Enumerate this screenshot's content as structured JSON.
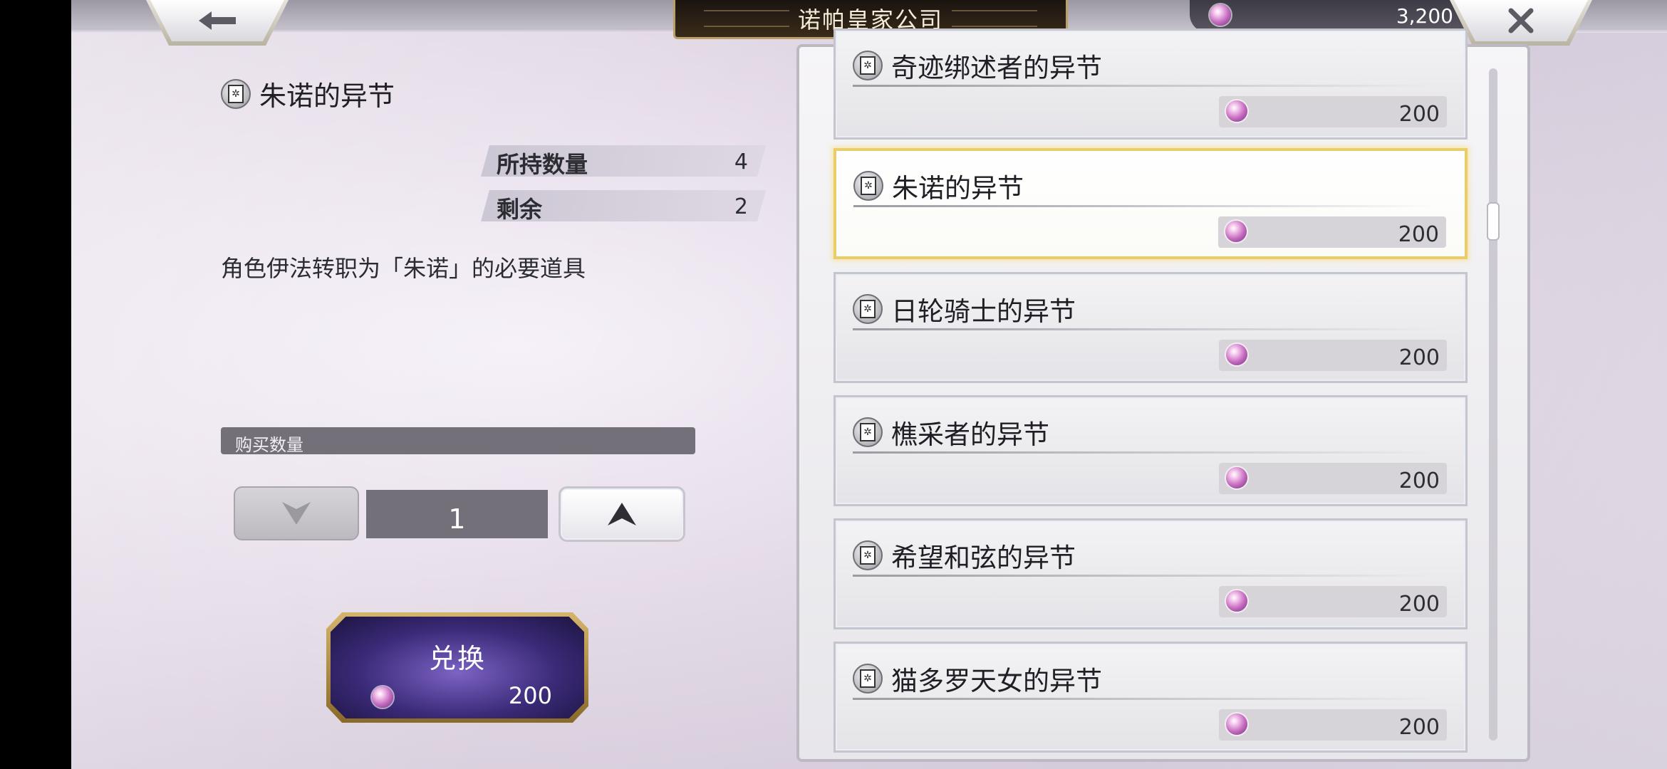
{
  "header": {
    "title": "诺帕皇家公司",
    "currency_value": "3,200",
    "back_icon": "left-arrow-icon",
    "close_icon": "close-x-icon"
  },
  "detail": {
    "item_name": "朱诺的异节",
    "owned_label": "所持数量",
    "owned_value": "4",
    "remaining_label": "剩余",
    "remaining_value": "2",
    "description": "角色伊法转职为「朱诺」的必要道具",
    "quantity_label": "购买数量",
    "quantity_value": "1",
    "exchange_label": "兑换",
    "exchange_cost": "200"
  },
  "list": {
    "items": [
      {
        "name": "奇迹绑述者的异节",
        "price": "200",
        "selected": false
      },
      {
        "name": "朱诺的异节",
        "price": "200",
        "selected": true
      },
      {
        "name": "日轮骑士的异节",
        "price": "200",
        "selected": false
      },
      {
        "name": "樵采者的异节",
        "price": "200",
        "selected": false
      },
      {
        "name": "希望和弦的异节",
        "price": "200",
        "selected": false
      },
      {
        "name": "猫多罗天女的异节",
        "price": "200",
        "selected": false
      }
    ]
  },
  "colors": {
    "selected_border": "#e9cd6d",
    "exchange_button": "#3b2a78",
    "gem": "#c56bbf"
  }
}
